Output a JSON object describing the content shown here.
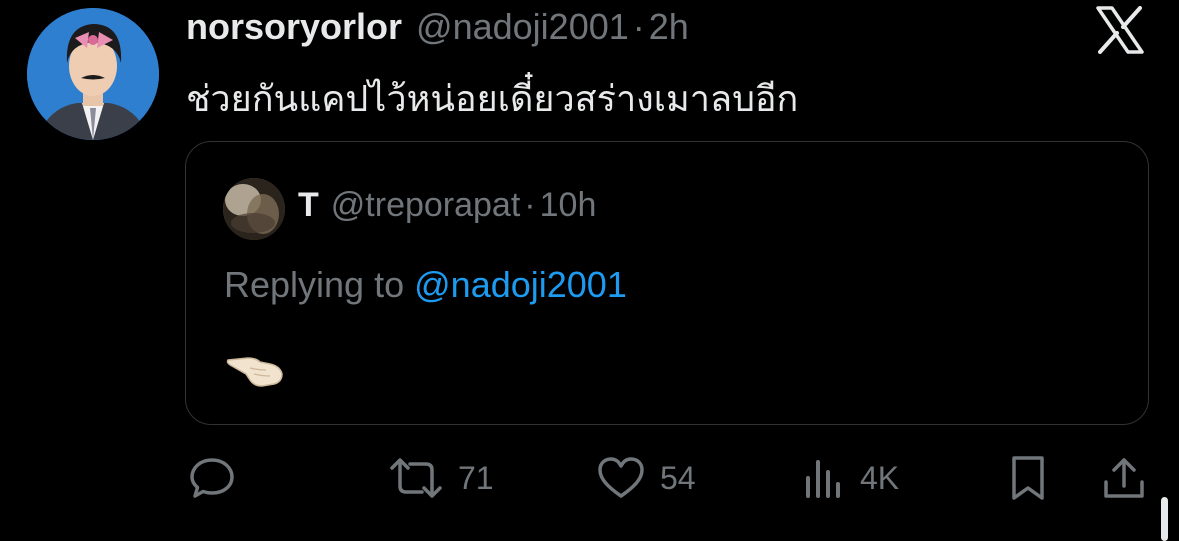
{
  "tweet": {
    "author_name": "norsoryorlor",
    "author_handle": "@nadoji2001",
    "separator": "·",
    "time": "2h",
    "text": "ช่วยกันแคปไว้หน่อยเดี๋ยวสร่างเมาลบอีก"
  },
  "quote": {
    "author_name": "T",
    "author_handle": "@treporapat",
    "separator": "·",
    "time": "10h",
    "replying_label": "Replying to",
    "replying_mention": "@nadoji2001",
    "emoji": "hand-icon"
  },
  "actions": {
    "reply": {
      "icon": "reply-icon"
    },
    "retweet": {
      "icon": "retweet-icon",
      "count": "71"
    },
    "like": {
      "icon": "heart-icon",
      "count": "54"
    },
    "views": {
      "icon": "views-icon",
      "count": "4K"
    },
    "bookmark": {
      "icon": "bookmark-icon"
    },
    "share": {
      "icon": "share-icon"
    }
  },
  "colors": {
    "background": "#000000",
    "text_primary": "#e7e9ea",
    "text_secondary": "#71767b",
    "link": "#1d9bf0",
    "border": "#2f3336"
  }
}
